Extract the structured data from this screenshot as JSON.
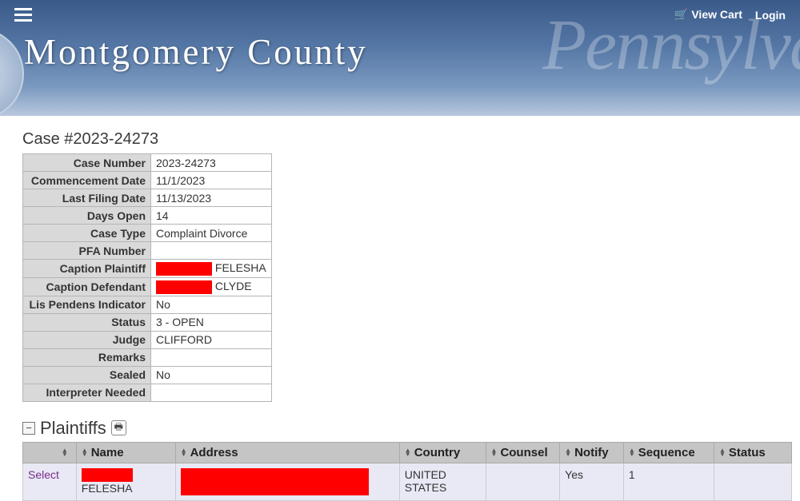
{
  "header": {
    "county_title": "Montgomery County",
    "view_cart": "View Cart",
    "login": "Login"
  },
  "case": {
    "heading": "Case #2023-24273",
    "fields": [
      {
        "label": "Case Number",
        "value": "2023-24273"
      },
      {
        "label": "Commencement Date",
        "value": "11/1/2023"
      },
      {
        "label": "Last Filing Date",
        "value": "11/13/2023"
      },
      {
        "label": "Days Open",
        "value": "14"
      },
      {
        "label": "Case Type",
        "value": "Complaint Divorce"
      },
      {
        "label": "PFA Number",
        "value": ""
      },
      {
        "label": "Caption Plaintiff",
        "value": "FELESHA",
        "redacted_prefix": true
      },
      {
        "label": "Caption Defendant",
        "value": "CLYDE",
        "redacted_prefix": true
      },
      {
        "label": "Lis Pendens Indicator",
        "value": "No"
      },
      {
        "label": "Status",
        "value": "3 - OPEN"
      },
      {
        "label": "Judge",
        "value": "CLIFFORD"
      },
      {
        "label": "Remarks",
        "value": ""
      },
      {
        "label": "Sealed",
        "value": "No"
      },
      {
        "label": "Interpreter Needed",
        "value": ""
      }
    ]
  },
  "plaintiffs": {
    "title": "Plaintiffs",
    "columns": [
      "",
      "Name",
      "Address",
      "Country",
      "Counsel",
      "Notify",
      "Sequence",
      "Status"
    ],
    "select_label": "Select",
    "rows": [
      {
        "name_visible": "FELESHA",
        "name_redacted": true,
        "address_redacted": true,
        "country": "UNITED STATES",
        "counsel": "",
        "notify": "Yes",
        "sequence": "1",
        "status": ""
      }
    ]
  }
}
